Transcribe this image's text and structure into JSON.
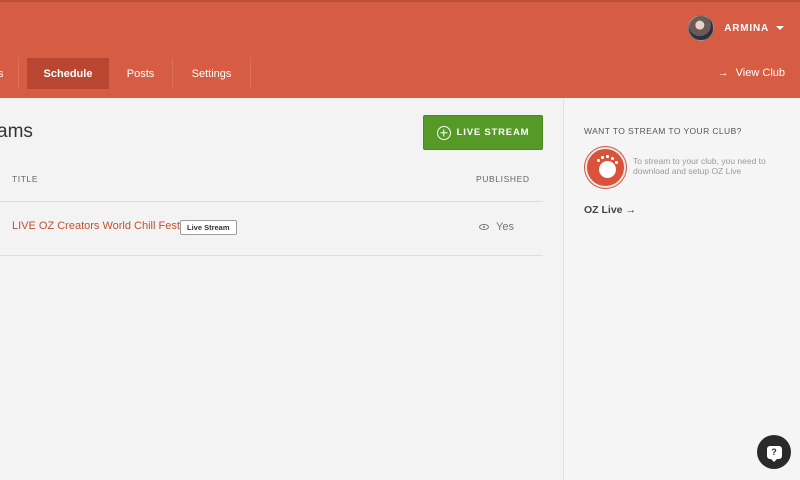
{
  "header": {
    "user_name": "ARMINA",
    "tabs": [
      {
        "label": "s"
      },
      {
        "label": "Schedule"
      },
      {
        "label": "Posts"
      },
      {
        "label": "Settings"
      }
    ],
    "view_club": "View Club"
  },
  "main": {
    "title": "ams",
    "live_stream_button": "LIVE STREAM",
    "columns": {
      "title": "TITLE",
      "published": "PUBLISHED"
    },
    "rows": [
      {
        "title": "LIVE OZ Creators World Chill Festival",
        "badge": "Live Stream",
        "published": "Yes"
      }
    ]
  },
  "sidebar": {
    "heading": "WANT TO STREAM TO YOUR CLUB?",
    "text": "To stream to your club, you need to download and setup OZ Live",
    "link": "OZ Live",
    "link_arrow": "→"
  },
  "help": {
    "icon_text": "?"
  },
  "colors": {
    "header": "#d65c43",
    "active_tab": "#b84630",
    "button_green": "#559a26",
    "link_red": "#c4502f"
  }
}
